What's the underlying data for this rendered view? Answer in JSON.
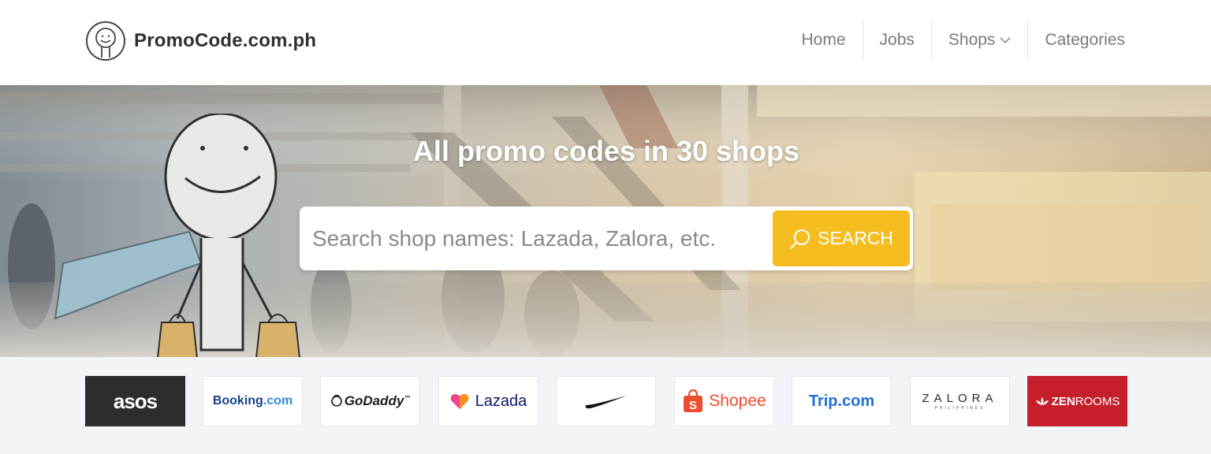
{
  "header": {
    "brand": "PromoCode.com.ph",
    "logo_icon": "smiley-mascot-icon",
    "nav": [
      {
        "label": "Home"
      },
      {
        "label": "Jobs"
      },
      {
        "label": "Shops",
        "icon": "chevron-down-icon"
      },
      {
        "label": "Categories"
      }
    ]
  },
  "hero": {
    "title": "All promo codes in 30 shops",
    "search": {
      "placeholder": "Search shop names: Lazada, Zalora, etc.",
      "value": "",
      "button_label": "SEARCH",
      "button_icon": "search-icon"
    }
  },
  "shops": [
    {
      "name": "asos"
    },
    {
      "name": "Booking",
      "suffix": ".com"
    },
    {
      "name": "GoDaddy",
      "mark": "™"
    },
    {
      "name": "Lazada"
    },
    {
      "name": "Nike",
      "icon": "nike-swoosh-icon"
    },
    {
      "name": "Shopee"
    },
    {
      "name": "Trip.com"
    },
    {
      "name": "ZALORA",
      "sub": "PHILIPPINES"
    },
    {
      "name_bold": "ZEN",
      "name_rest": "ROOMS"
    }
  ],
  "colors": {
    "accent": "#f5bd1f",
    "header_bg": "#ffffff",
    "strip_bg": "#f2f4f8",
    "asos_bg": "#2d2d2d",
    "zenrooms_bg": "#c41f2b",
    "shopee": "#ee4d2d",
    "trip": "#1e6fd9"
  }
}
